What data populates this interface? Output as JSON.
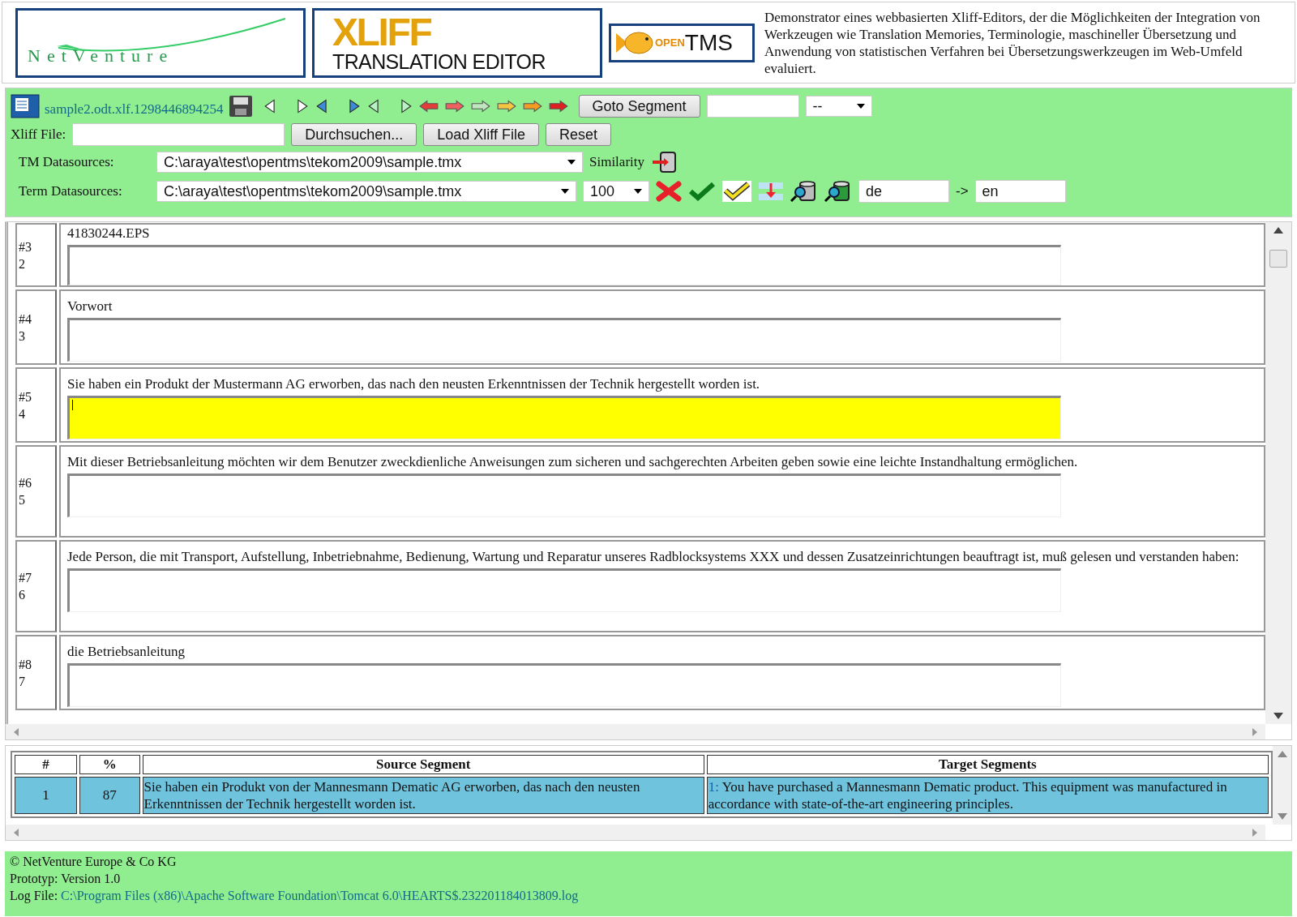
{
  "header": {
    "netventure_logo": "NetVenture",
    "xliff_logo": {
      "title": "XLIFF",
      "subtitle": "TRANSLATION EDITOR"
    },
    "opentms_logo": {
      "prefix": "OPEN",
      "name": "TMS"
    },
    "description": "Demonstrator eines webbasierten Xliff-Editors, der die Möglichkeiten der Integration von Werkzeugen wie Translation Memories, Terminologie, maschineller Übersetzung und Anwendung von statistischen Verfahren bei Übersetzungswerkzeugen im Web-Umfeld evaluiert."
  },
  "toolbar": {
    "file_name": "sample2.odt.xlf.1298446894254",
    "goto_button": "Goto Segment",
    "segment_select": "--",
    "xliff_label": "Xliff File:",
    "buttons": [
      "Durchsuchen...",
      "Load Xliff File",
      "Reset"
    ],
    "tm_label": "TM Datasources:",
    "tm_source": "C:\\araya\\test\\opentms\\tekom2009\\sample.tmx",
    "similarity_label": "Similarity",
    "term_label": "Term Datasources:",
    "term_source": "C:\\araya\\test\\opentms\\tekom2009\\sample.tmx",
    "similarity_value": "100",
    "source_lang": "de",
    "lang_arrow": "->",
    "target_lang": "en"
  },
  "segments": [
    {
      "id": "#3",
      "number": "2",
      "source": "41830244.EPS",
      "active": false
    },
    {
      "id": "#4",
      "number": "3",
      "source": "Vorwort",
      "active": false
    },
    {
      "id": "#5",
      "number": "4",
      "source": "Sie haben ein Produkt der Mustermann AG erworben, das nach den neusten Erkenntnissen der Technik hergestellt worden ist.",
      "active": true
    },
    {
      "id": "#6",
      "number": "5",
      "source": "Mit dieser Betriebsanleitung möchten wir dem Benutzer zweckdienliche Anweisungen zum sicheren und sachgerechten Arbeiten geben sowie eine leichte Instandhaltung ermöglichen.",
      "active": false
    },
    {
      "id": "#7",
      "number": "6",
      "source": "Jede Person, die mit Transport, Aufstellung, Inbetriebnahme, Bedienung, Wartung und Reparatur unseres Radblocksystems XXX und dessen Zusatzeinrichtungen beauftragt ist, muß gelesen und verstanden haben:",
      "active": false
    },
    {
      "id": "#8",
      "number": "7",
      "source": "die Betriebsanleitung",
      "active": false
    }
  ],
  "results": {
    "columns": [
      "#",
      "%",
      "Source Segment",
      "Target Segments"
    ],
    "rows": [
      {
        "index": "1",
        "score": "87",
        "source": "Sie haben ein Produkt von der Mannesmann Dematic AG erworben, das nach den neusten Erkenntnissen der Technik hergestellt worden ist.",
        "target_number": "1:",
        "target": "You have purchased a Mannesmann Dematic product. This equipment was manufactured in accordance with state-of-the-art engineering principles."
      }
    ]
  },
  "footer": {
    "copyright": "© NetVenture Europe & Co KG",
    "version": "Prototyp: Version 1.0",
    "log_label": "Log File:",
    "log_path": "C:\\Program Files (x86)\\Apache Software Foundation\\Tomcat 6.0\\HEARTS$.232201184013809.log"
  }
}
